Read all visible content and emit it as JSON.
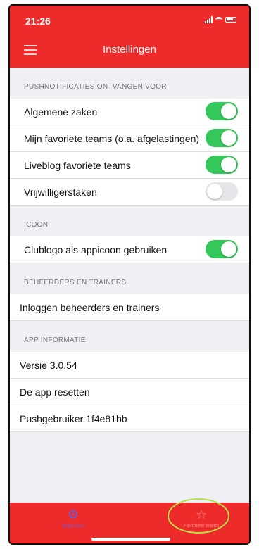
{
  "status_bar": {
    "time": "21:26"
  },
  "navbar": {
    "title": "Instellingen"
  },
  "sections": {
    "push": {
      "header": "PUSHNOTIFICATIES ONTVANGEN VOOR",
      "rows": [
        {
          "label": "Algemene zaken",
          "on": true
        },
        {
          "label": "Mijn favoriete teams (o.a. afgelastingen)",
          "on": true
        },
        {
          "label": "Liveblog favoriete teams",
          "on": true
        },
        {
          "label": "Vrijwilligerstaken",
          "on": false
        }
      ]
    },
    "icon": {
      "header": "ICOON",
      "rows": [
        {
          "label": "Clublogo als appicoon gebruiken",
          "on": true
        }
      ]
    },
    "admins": {
      "header": "BEHEERDERS EN TRAINERS",
      "rows": [
        {
          "label": "Inloggen beheerders en trainers"
        }
      ]
    },
    "info": {
      "header": "APP INFORMATIE",
      "rows": [
        {
          "label": "Versie 3.0.54"
        },
        {
          "label": "De app resetten"
        },
        {
          "label": "Pushgebruiker 1f4e81bb"
        }
      ]
    }
  },
  "tabbar": {
    "general_label": "Algemeen",
    "general_icon": "gear-icon",
    "favorites_label": "Favoriete teams",
    "favorites_icon": "star-icon"
  },
  "colors": {
    "brand_red": "#ee2b2b",
    "toggle_on": "#34c759",
    "toggle_off": "#e6e6ea",
    "annotation": "#b7e04a"
  }
}
